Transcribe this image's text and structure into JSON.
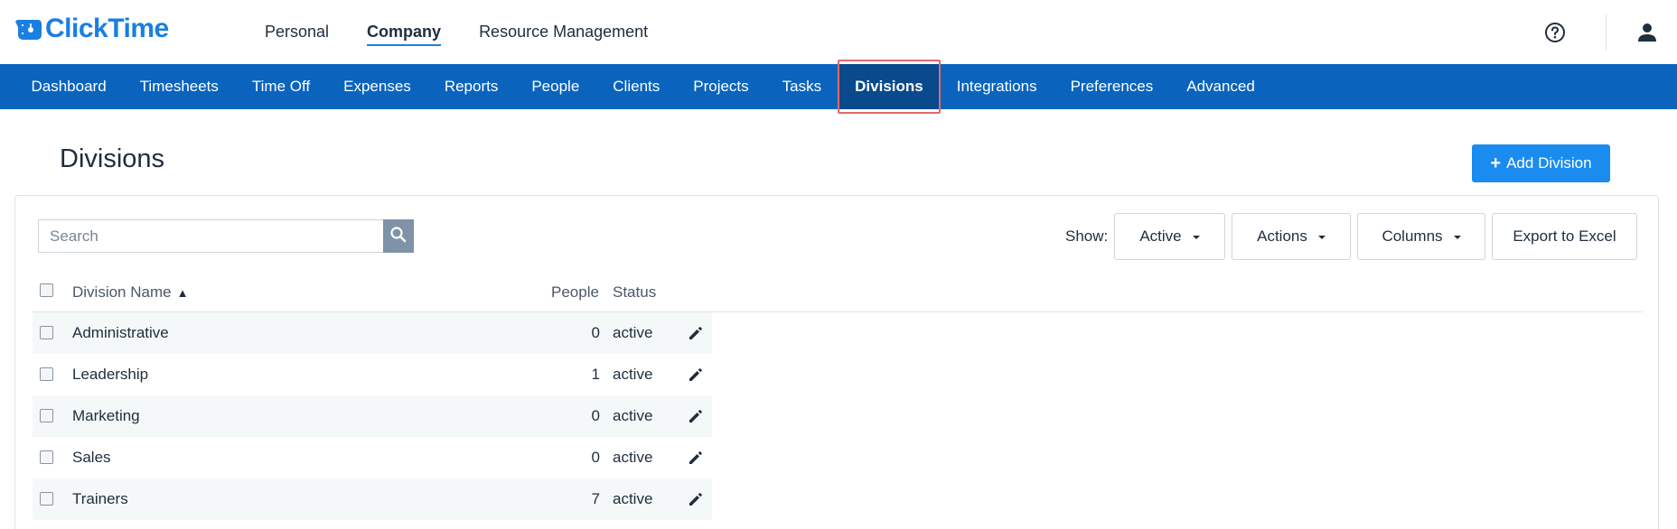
{
  "brand": {
    "name": "ClickTime",
    "color": "#1a7fe0"
  },
  "top_nav": [
    {
      "label": "Personal",
      "active": false
    },
    {
      "label": "Company",
      "active": true
    },
    {
      "label": "Resource Management",
      "active": false
    }
  ],
  "top_right": {
    "help_icon": "question-circle-icon",
    "user_icon": "user-icon"
  },
  "main_nav": {
    "background": "#0a64be",
    "items": [
      {
        "label": "Dashboard"
      },
      {
        "label": "Timesheets"
      },
      {
        "label": "Time Off"
      },
      {
        "label": "Expenses"
      },
      {
        "label": "Reports"
      },
      {
        "label": "People"
      },
      {
        "label": "Clients"
      },
      {
        "label": "Projects"
      },
      {
        "label": "Tasks"
      },
      {
        "label": "Divisions",
        "active": true
      },
      {
        "label": "Integrations"
      },
      {
        "label": "Preferences"
      },
      {
        "label": "Advanced"
      }
    ]
  },
  "page": {
    "title": "Divisions",
    "add_button_label": "Add Division",
    "add_button_icon": "plus-icon"
  },
  "toolbar": {
    "search_placeholder": "Search",
    "search_icon": "search-icon",
    "show_label": "Show:",
    "show_value": "Active",
    "actions_label": "Actions",
    "columns_label": "Columns",
    "export_label": "Export to Excel"
  },
  "table": {
    "headers": {
      "name": "Division Name",
      "sort_indicator": "▲",
      "people": "People",
      "status": "Status"
    },
    "rows": [
      {
        "name": "Administrative",
        "people": "0",
        "status": "active"
      },
      {
        "name": "Leadership",
        "people": "1",
        "status": "active"
      },
      {
        "name": "Marketing",
        "people": "0",
        "status": "active"
      },
      {
        "name": "Sales",
        "people": "0",
        "status": "active"
      },
      {
        "name": "Trainers",
        "people": "7",
        "status": "active"
      }
    ],
    "row_action_icon": "pencil-edit-icon"
  }
}
